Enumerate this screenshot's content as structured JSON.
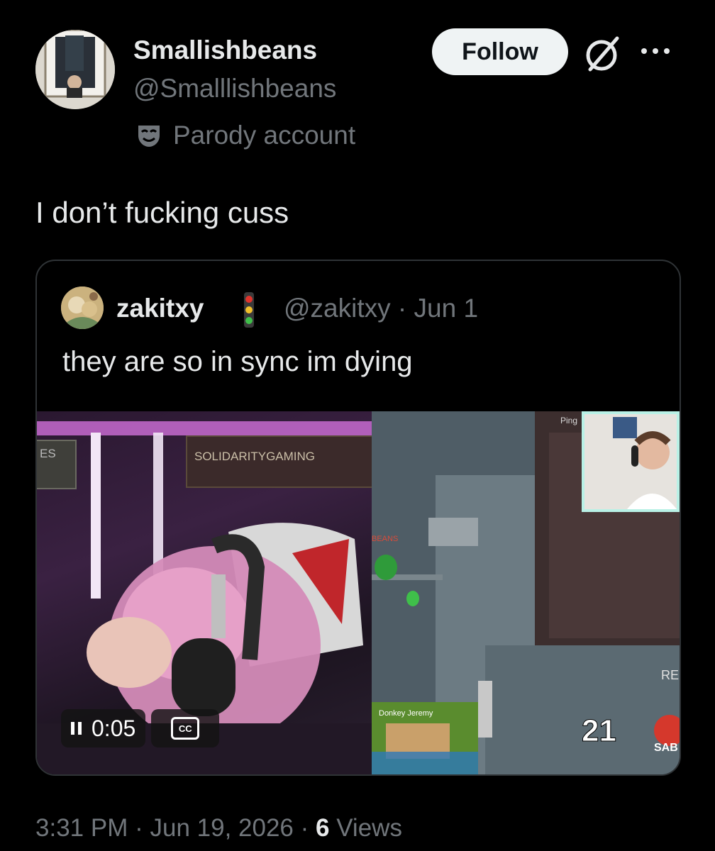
{
  "author": {
    "display_name": "Smallishbeans",
    "handle": "@Smalllishbeans",
    "label": "Parody account"
  },
  "actions": {
    "follow_label": "Follow"
  },
  "tweet": {
    "text": "I don’t fucking cuss"
  },
  "quoted": {
    "name": "zakitxy",
    "handle_date": "@zakitxy · Jun 1",
    "text": "they are so in sync im dying",
    "video": {
      "time": "0:05",
      "cc_label": "CC",
      "banner_text": "SOLIDARITYGAMING",
      "left_badge": "ES",
      "ping_label": "Ping",
      "player_label": "BEANS",
      "minecraft_label": "Donkey Jeremy",
      "counter": "21",
      "sab_label": "SAB",
      "re_label": "RE"
    }
  },
  "meta": {
    "time": "3:31 PM",
    "date": "Jun 19, 2026",
    "views_count": "6",
    "views_label": "Views"
  }
}
